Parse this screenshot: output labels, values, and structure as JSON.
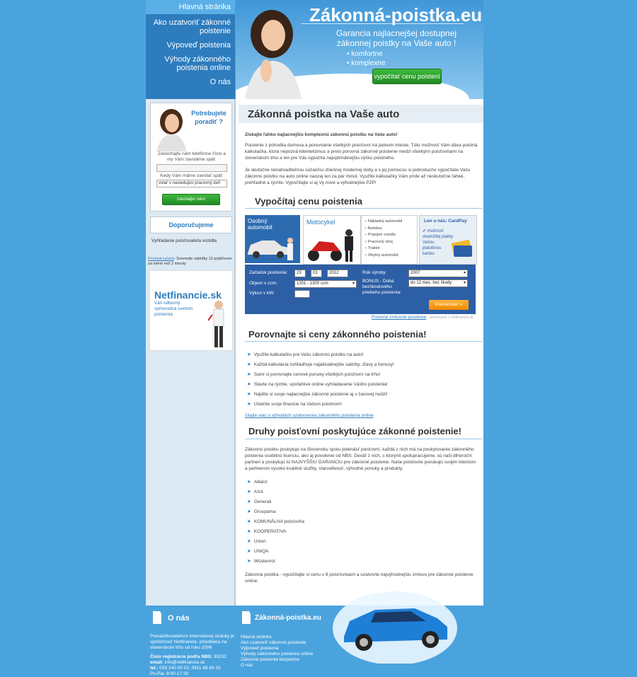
{
  "colors": {
    "header": "#4aa3dd",
    "nav": "#2d7cbd",
    "accent_green": "#2ea02e",
    "orange": "#f08a00",
    "form_blue": "#2d5fa6"
  },
  "nav": {
    "items": [
      "Hlavná stránka",
      "Ako uzatvoriť zákonné poistenie",
      "Výpoveď poistenia",
      "Výhody zákonného poistenia online",
      "O nás"
    ]
  },
  "hero": {
    "site_title": "Zákonná-poistka.eu",
    "slogan": "Garancia najlacnejšej dostupnej zákonnej poistky na Vaše auto !",
    "bullets": [
      "komfortne",
      "komplexne"
    ],
    "calc_button": "vypočítať cenu poistení"
  },
  "sidebar": {
    "advice_title": "Potrebujete poradiť ?",
    "callback_text": "Zanechajte nám telefónne číslo a my Vám zavoláme späť.",
    "when_label": "Kedy Vám máme zavolať späť:",
    "when_select": "volať v nasledujúci pracovný deň",
    "call_button": "zavolajte nám",
    "recommend_title": "Doporučujeme",
    "recommend_item": "Vyhľadanie poisťovateľa vozidla",
    "ad_link": "Povinné ručení",
    "ad_text": "- Srovnejte nabídky 13 pojišťoven za méně než 2 minuty",
    "banner_logo": "Netfinancie.sk",
    "banner_tagline": "Váš odborný sprievodca svetom poistenia"
  },
  "main": {
    "title": "Zákonná poistka na Vaše auto",
    "lead": "Získajte ľahko najlacnejšiu komplexnú zákonnú poistku na Vaše auto!",
    "p1": "Poistenie z pohodlia domova a porovnanie všetkých poisťovní na jednom mieste. Túto možnosť Vám dáva poistná kalkulačka, ktorá nepozná klientelizmus a preto porovná zákonné poistenie medzi všetkými poisťovňami na slovenskom trhu a len pre Vás vypočíta najoptimálnejšiu výšku poistného.",
    "p2": "Je skutočne nenahraditeľnou súčasťou dnešnej modernej doby a s jej pomocou si jednoducho vypočítate Vašu zákonnú poistku na auto online naozaj len za pár minút. Využite kalkulačky Vám príde až neskutočne ľahké, prehľadné a rýchle. Vypočítajte si aj Vy nové a výhodnejšie PZP!",
    "calc_heading": "Vypočítaj cenu poistenia",
    "compare_heading": "Porovnajte si ceny zákonného poistenia!",
    "compare_items": [
      "Využite kalkulačku pre Vašu zákonnú poistku na auto!",
      "Každá kalkulácia zohľadňuje najaktuálnejšie sadzby, zľavy a bonusy!",
      "Sami si porovnajte cenové ponuky všetkých poisťovní na trhu!",
      "Stavte na rýchle, spoľahlivé online vyhľadávanie Vášho poistenia!",
      "Nájdite si svoje najlacnejšie zákonné poistenie aj v časovej núdzi!",
      "Ušetrite svoje financie na Vašom poistnom!"
    ],
    "more_link": "čítajte viac o výhodách uzatvorenia zákonného poistenia online",
    "insurers_heading": "Druhy poisťovní poskytujúce zákonné poistenie!",
    "insurers_text": "Zákonnú poistku poskytuje na Slovensku spolu jedenásť poisťovní, každá z nich má na poskytovanie zákonného poistenia osobitnú licenciu, ako aj povolenie od NBS. Deväť z nich, s ktorými spolupracujeme, sú naši dlhoroční partneri a poskytujú tú NAJVYŠŠIU GARANCIU pre zákonné poistenie. Naše poistovne ponúkajú svojim klientom a partnerom vysoko kvalitné služby, starostlivosť, výhodné ponuky a produkty.",
    "insurers": [
      "Allianz",
      "AXA",
      "Generali",
      "Groupama",
      "KOMUNÁLNA poisťovňa",
      "KOOPERATIVA",
      "Union",
      "UNIQA",
      "Wüstenrot"
    ],
    "closing": "Zákonná poistka - vypočítajte si cenu v 9 poisťovniach a uzatvorte najvýhodnejšiu zmluvu pre zákonné poistenie online."
  },
  "calc": {
    "tab_car": "Osobný automobil",
    "tab_moto": "Motocykel",
    "vehicle_types": [
      "Nákladný automobil",
      "Autobus",
      "Prípojné vozidlo",
      "Pracovný stroj",
      "Traktor",
      "Obytný automobil"
    ],
    "cardpay_title": "Len u nás: CardPay",
    "cardpay_text": "možnosť okamžitej platby Vašou platobnou kartou",
    "start_label": "Začiatok poistenia:",
    "start_day": "23",
    "start_month": "01",
    "start_year": "2012",
    "year_label": "Rok výroby:",
    "year_value": "2007",
    "volume_label": "Objem v ccm:",
    "volume_value": "1201 - 1300 ccm",
    "bonus_label": "BONUS - Doba bezškodového priebehu poistenia:",
    "bonus_value": "do 12 mes. bez škody",
    "power_label": "Výkon v kW:",
    "continue_button": "Pokračovať »",
    "footer_link": "Povinné zmluvné poistenie",
    "footer_note": "- porovnanie s Netfinancie.sk"
  },
  "footer": {
    "about_title": "O nás",
    "about_text": "Prevádzkovateľom internetovej stránky je spoločnosť Netfinancie, pôsobiaca na slovenskom trhu od roku 2006",
    "nbs_label": "Číslo registrácie podľa NBS:",
    "nbs_value": "30232",
    "email_label": "email:",
    "email_value": "info@netfinancie.sk",
    "tel_label": "tel.:",
    "tel_value": "033 240 00 02, 0911 69 69 20",
    "hours": "Po-Pia: 8:00-17:30",
    "site_title": "Zákonná-poistka.eu",
    "links": [
      "Hlavná stránka",
      "Ako uzatvoriť zákonné poistenie",
      "Výpoveď poistenia",
      "Výhody zákonného poistenia online",
      "Zákonné poistenie bezpečne",
      "O nás"
    ]
  }
}
